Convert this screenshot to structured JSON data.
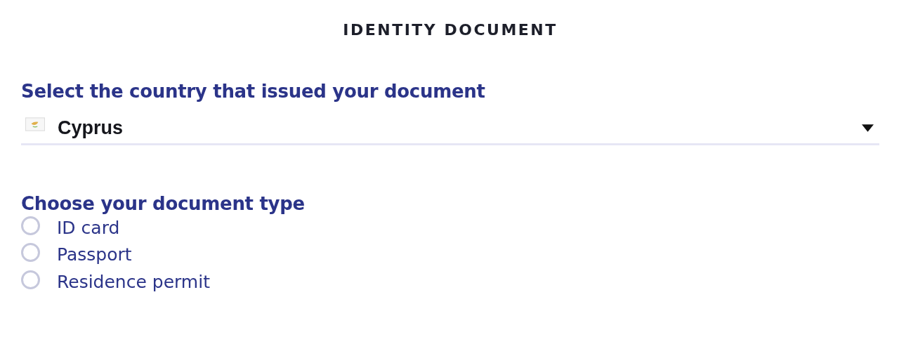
{
  "title": "IDENTITY DOCUMENT",
  "country": {
    "label": "Select the country that issued your document",
    "value": "Cyprus"
  },
  "document_type": {
    "label": "Choose your document type",
    "options": [
      {
        "label": "ID card",
        "selected": false
      },
      {
        "label": "Passport",
        "selected": false
      },
      {
        "label": "Residence permit",
        "selected": false
      }
    ]
  }
}
